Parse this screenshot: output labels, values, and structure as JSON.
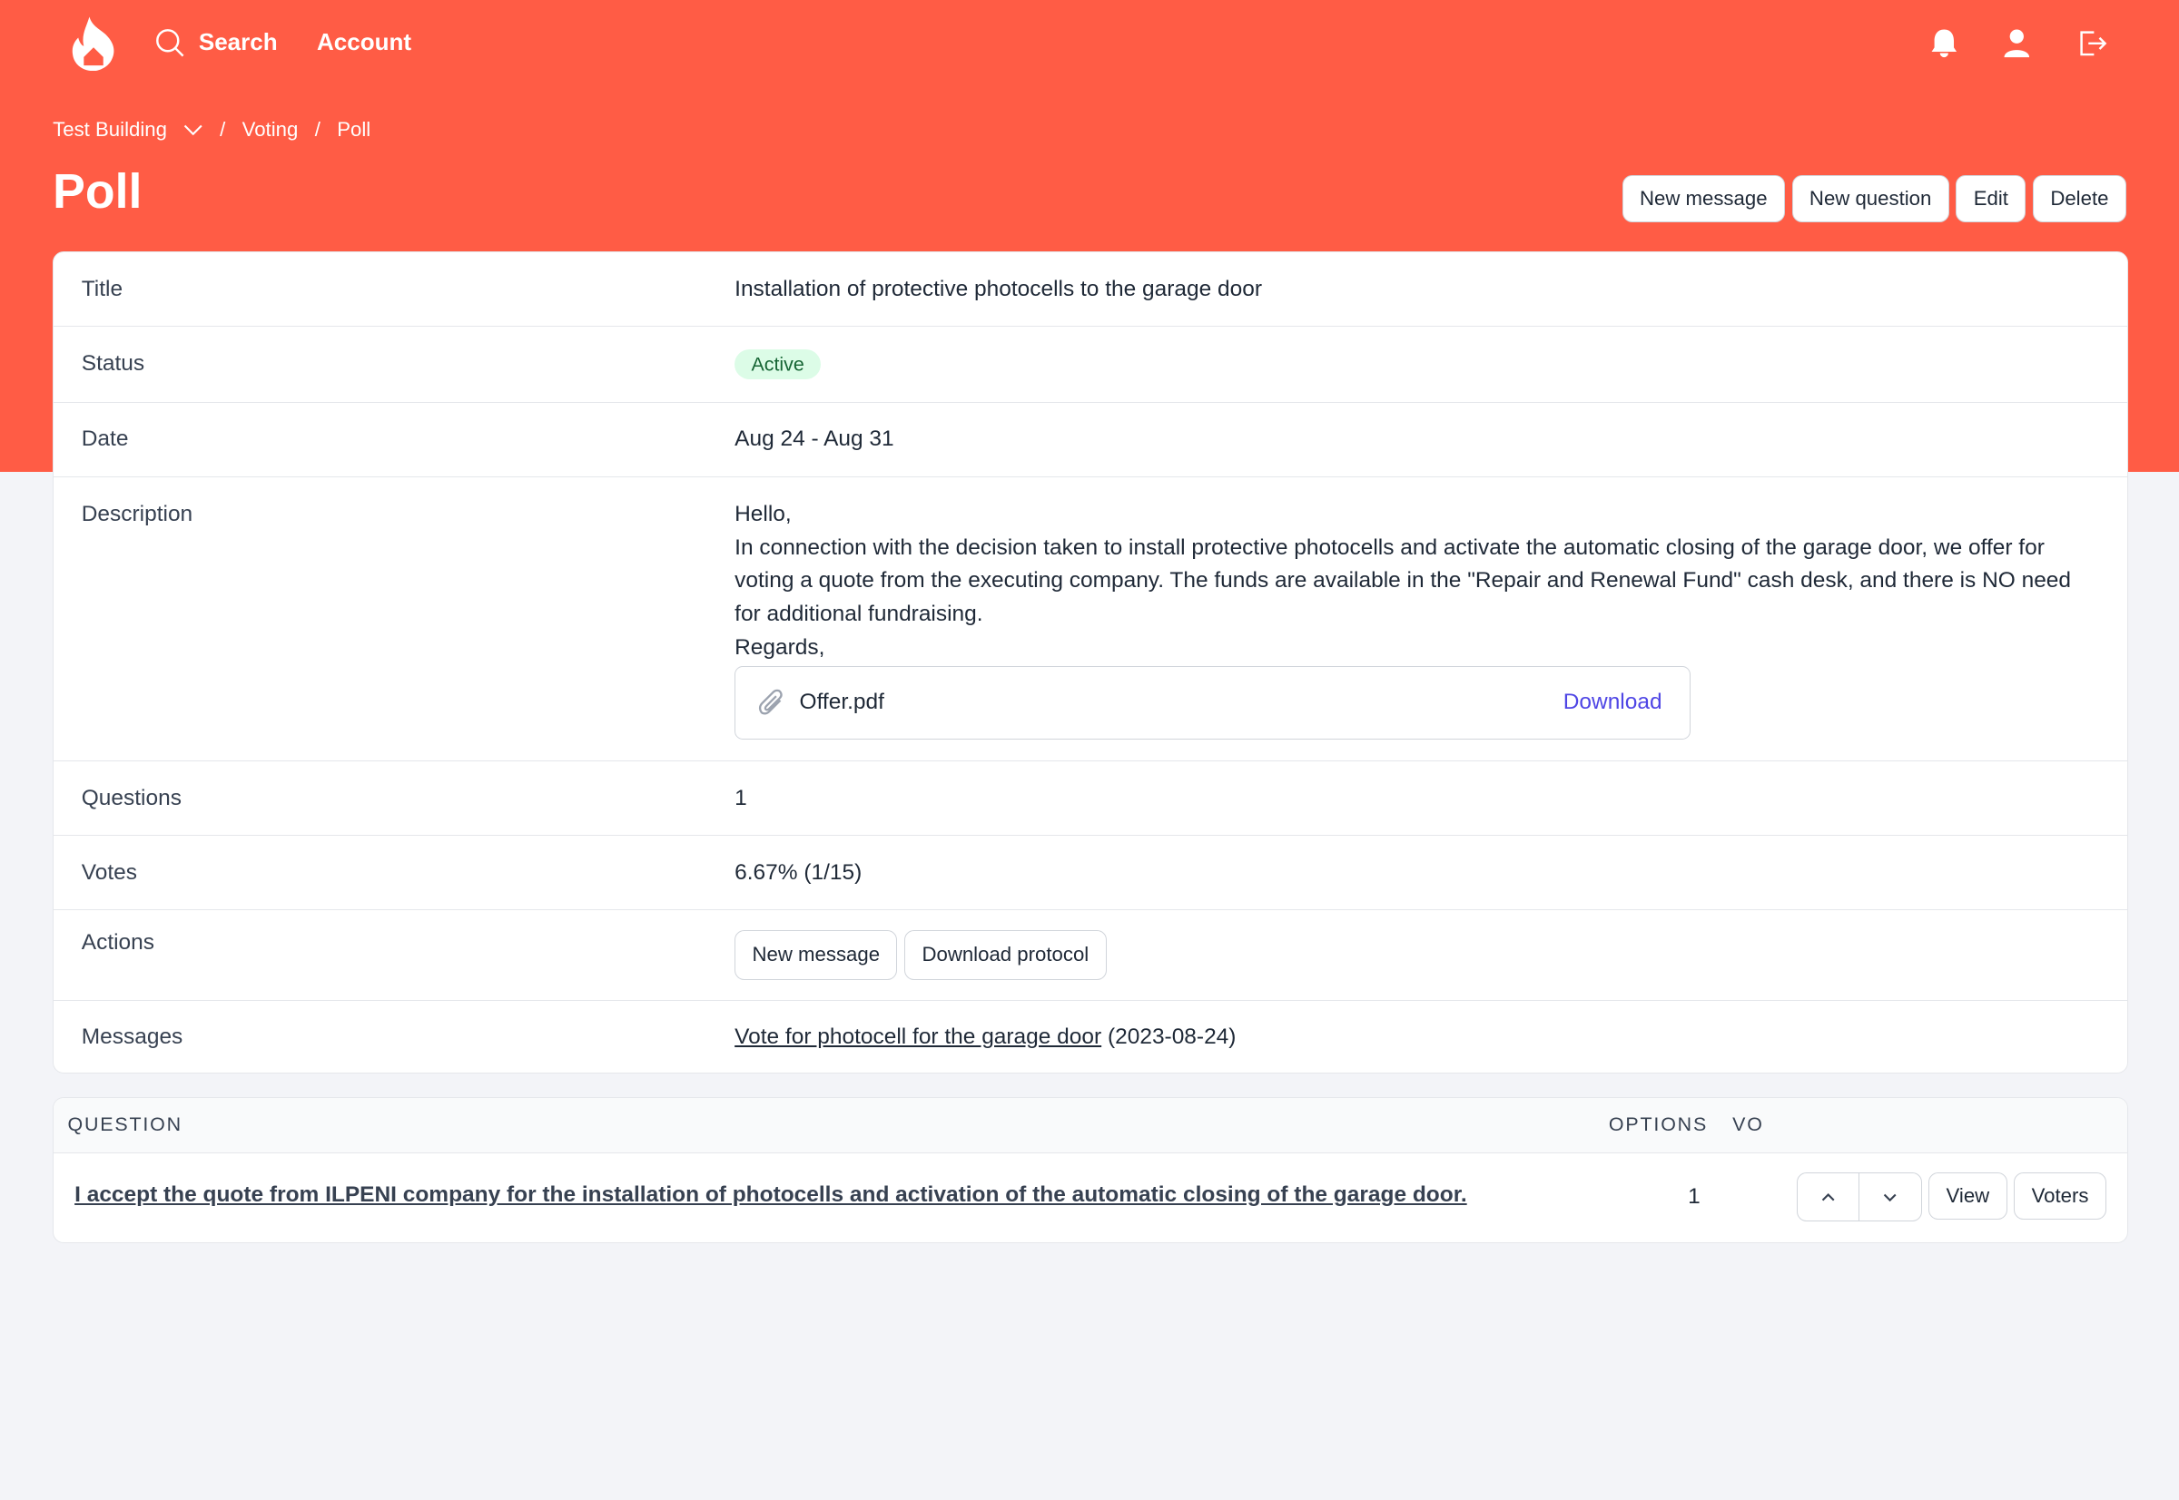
{
  "nav": {
    "search": "Search",
    "account": "Account",
    "icons": [
      "flame-house-logo",
      "search-icon",
      "bell-icon",
      "user-icon",
      "logout-icon"
    ]
  },
  "breadcrumb": [
    "Test Building",
    "Voting",
    "Poll"
  ],
  "page_title": "Poll",
  "header_buttons": {
    "new_message": "New message",
    "new_question": "New question",
    "edit": "Edit",
    "delete": "Delete"
  },
  "details": {
    "title": {
      "label": "Title",
      "value": "Installation of protective photocells to the garage door"
    },
    "status": {
      "label": "Status",
      "value": "Active"
    },
    "date": {
      "label": "Date",
      "value": "Aug 24 - Aug 31"
    },
    "description": {
      "label": "Description",
      "lines": [
        "Hello,",
        "In connection with the decision taken to install protective photocells and activate the automatic closing of the garage door, we offer for voting a quote from the executing company. The funds are available in the \"Repair and Renewal Fund\" cash desk, and there is NO need for additional fundraising.",
        "Regards,"
      ],
      "attachment": {
        "name": "Offer.pdf",
        "action": "Download"
      }
    },
    "questions": {
      "label": "Questions",
      "value": "1"
    },
    "votes": {
      "label": "Votes",
      "value": "6.67% (1/15)"
    },
    "actions": {
      "label": "Actions",
      "new_message": "New message",
      "download_protocol": "Download protocol"
    },
    "messages": {
      "label": "Messages",
      "link": "Vote for photocell for the garage door",
      "date": "(2023-08-24)"
    }
  },
  "questions_table": {
    "headers": [
      "QUESTION",
      "OPTIONS",
      "VO"
    ],
    "rows": [
      {
        "question": "I accept the quote from ILPENI company for the installation of photocells and activation of the automatic closing of the garage door.",
        "options": "1",
        "view": "View",
        "voters": "Voters"
      }
    ]
  },
  "colors": {
    "brand": "#ff5c45",
    "link": "#4f46e5",
    "active_bg": "#dcfce7"
  }
}
